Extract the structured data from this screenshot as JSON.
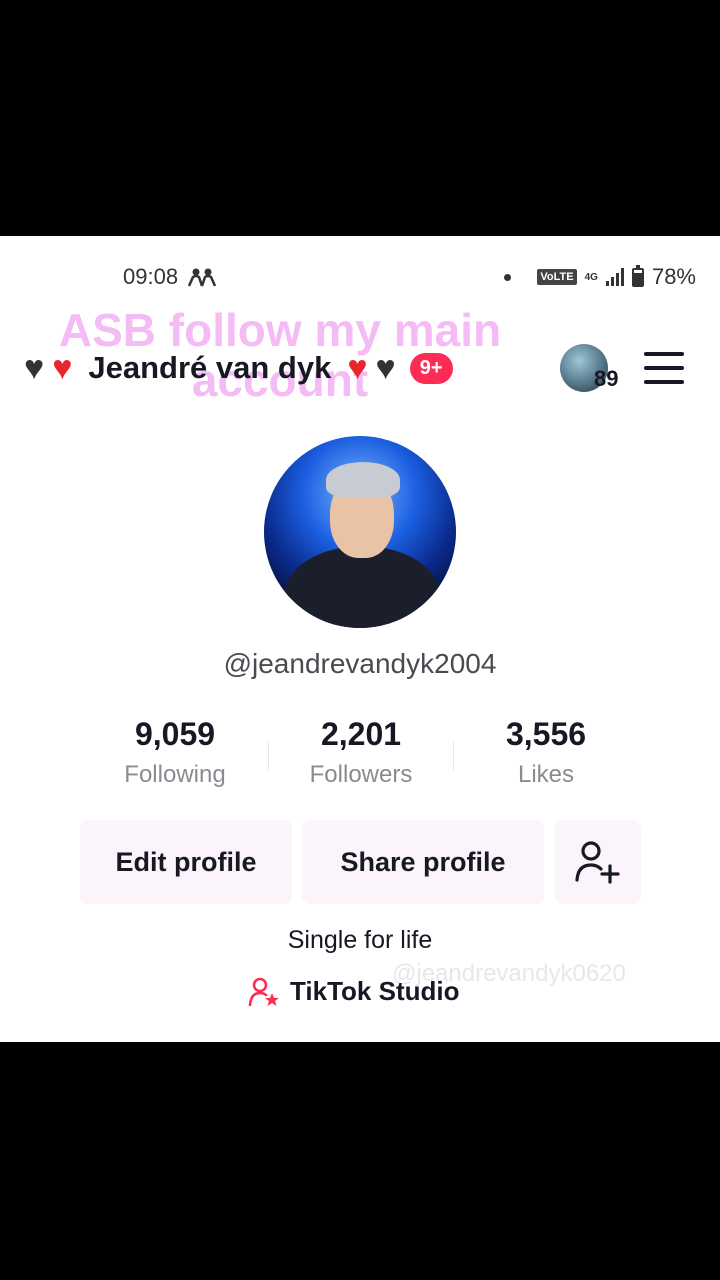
{
  "status_bar": {
    "time": "09:08",
    "battery": "78%",
    "volte": "VoLTE",
    "network": "4G"
  },
  "overlay_text": [
    "ASB follow my main",
    "account"
  ],
  "header": {
    "display_name": "Jeandré van dyk",
    "notification_badge": "9+",
    "story_count": "89"
  },
  "profile": {
    "handle": "@jeandrevandyk2004",
    "bio": "Single for life",
    "studio_link": "TikTok Studio",
    "watermark": "@jeandrevandyk0620"
  },
  "stats": [
    {
      "value": "9,059",
      "label": "Following"
    },
    {
      "value": "2,201",
      "label": "Followers"
    },
    {
      "value": "3,556",
      "label": "Likes"
    }
  ],
  "buttons": {
    "edit_profile": "Edit profile",
    "share_profile": "Share profile"
  },
  "colors": {
    "accent": "#fe2c55",
    "overlay": "#f4b8f4",
    "button_bg": "#fbf4fb",
    "letterbox": "#000000"
  },
  "icons": [
    "people-icon",
    "signal-icon",
    "battery-icon",
    "black-heart-icon",
    "red-heart-icon",
    "hamburger-menu-icon",
    "add-friend-icon",
    "creator-star-icon"
  ]
}
